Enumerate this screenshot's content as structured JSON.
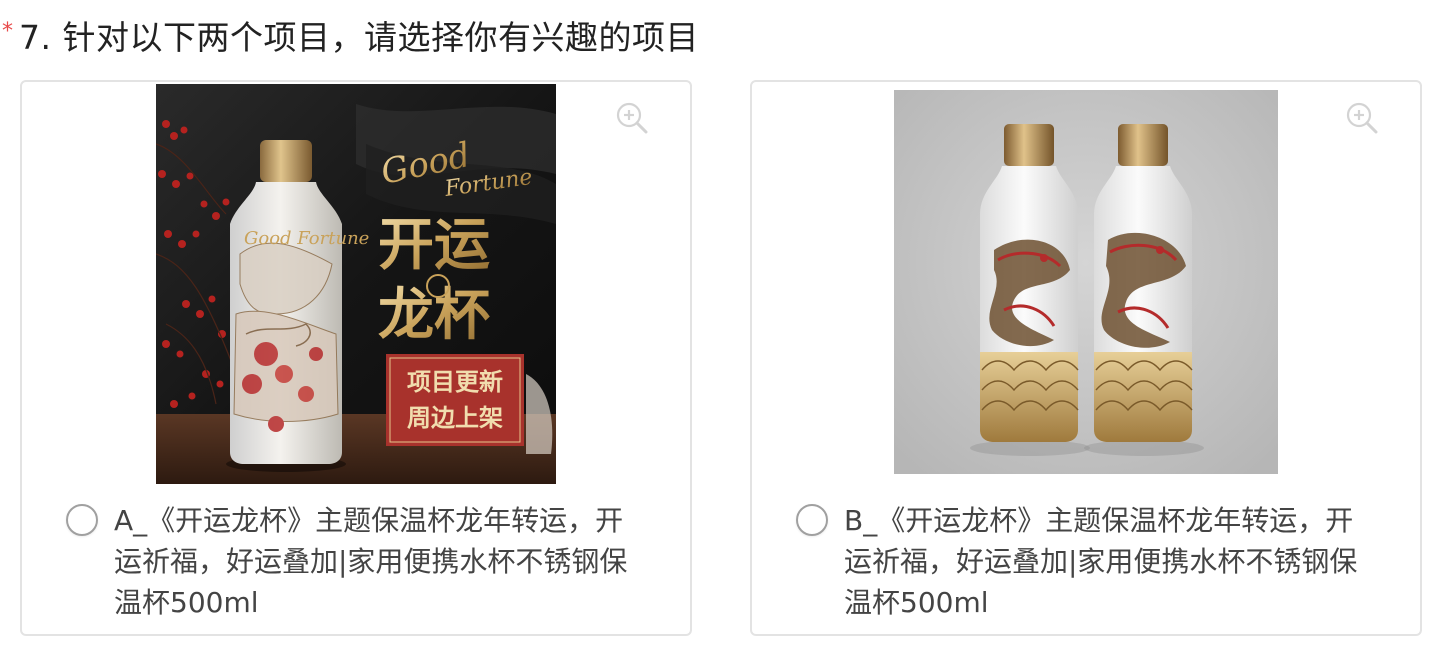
{
  "question": {
    "required_mark": "*",
    "text": "7. 针对以下两个项目，请选择你有兴趣的项目"
  },
  "options": [
    {
      "label": "A_《开运龙杯》主题保温杯龙年转运，开运祈福，好运叠加|家用便携水杯不锈钢保温杯500ml",
      "image": {
        "title_calligraphy": "Good Fortune",
        "title_cn": [
          "开运",
          "龙杯"
        ],
        "badge_text": [
          "项目更新",
          "周边上架"
        ],
        "bottle_script": "Good Fortune"
      },
      "selected": false
    },
    {
      "label": "B_《开运龙杯》主题保温杯龙年转运，开运祈福，好运叠加|家用便携水杯不锈钢保温杯500ml",
      "selected": false
    }
  ],
  "icons": {
    "zoom": "zoom-in-icon",
    "radio": "radio-button-icon"
  },
  "colors": {
    "required": "#e84a4a",
    "border": "#e3e3e3",
    "badge_red": "#a8322c",
    "gold": "#c9a25a"
  }
}
